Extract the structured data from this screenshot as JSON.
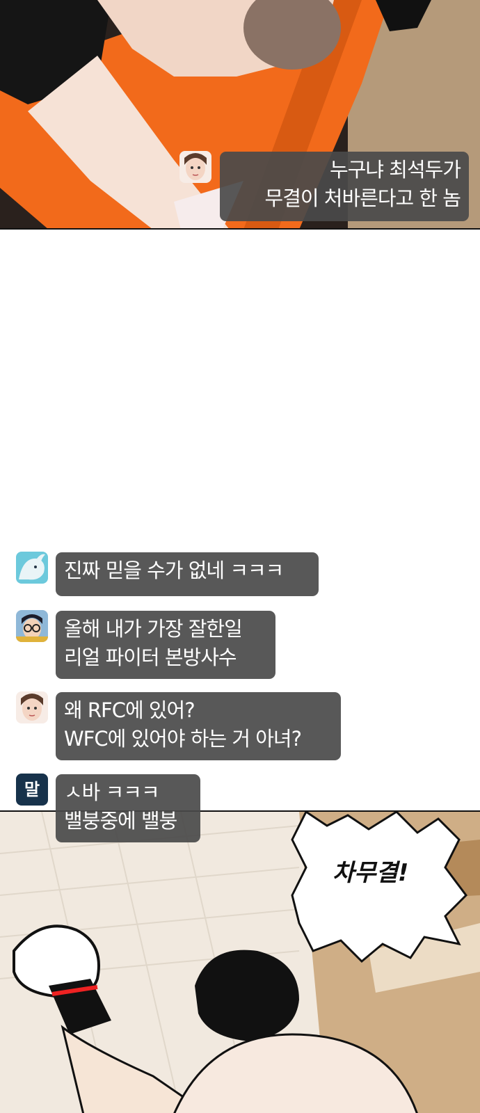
{
  "chat": [
    {
      "avatar": "woman-face-icon",
      "lines": [
        "누구냐 최석두가",
        "무결이 처바른다고 한 놈"
      ]
    },
    {
      "avatar": "whale-icon",
      "lines": [
        "진짜 믿을 수가 없네 ㅋㅋㅋ"
      ]
    },
    {
      "avatar": "glasses-man-icon",
      "lines": [
        "올해 내가 가장 잘한일",
        "리얼 파이터 본방사수"
      ]
    },
    {
      "avatar": "woman-face-icon",
      "lines": [
        "왜 RFC에 있어?",
        "WFC에 있어야 하는 거 아녀?"
      ]
    },
    {
      "avatar": "text-avatar",
      "avatar_text": "말",
      "lines": [
        "ㅅ바 ㅋㅋㅋ",
        "밸붕중에 밸붕"
      ]
    }
  ],
  "shout": "차무결!",
  "colors": {
    "bubble": "#4a4a4a",
    "orange": "#f26a1b",
    "avatar_navy": "#17324b"
  }
}
